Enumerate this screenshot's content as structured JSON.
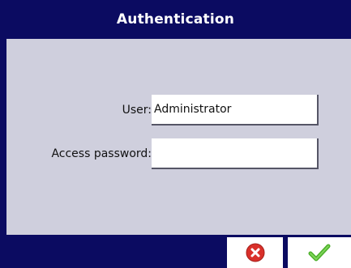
{
  "window": {
    "title": "Authentication"
  },
  "form": {
    "user_label": "User:",
    "user_value": "Administrator",
    "password_label": "Access password:",
    "password_value": ""
  },
  "buttons": {
    "cancel_icon": "cancel-icon",
    "confirm_icon": "checkmark-icon"
  },
  "colors": {
    "header_bg": "#0b0b61",
    "content_bg": "#cfcfdd",
    "cancel_red": "#d9302a",
    "confirm_green": "#4caf2a"
  }
}
